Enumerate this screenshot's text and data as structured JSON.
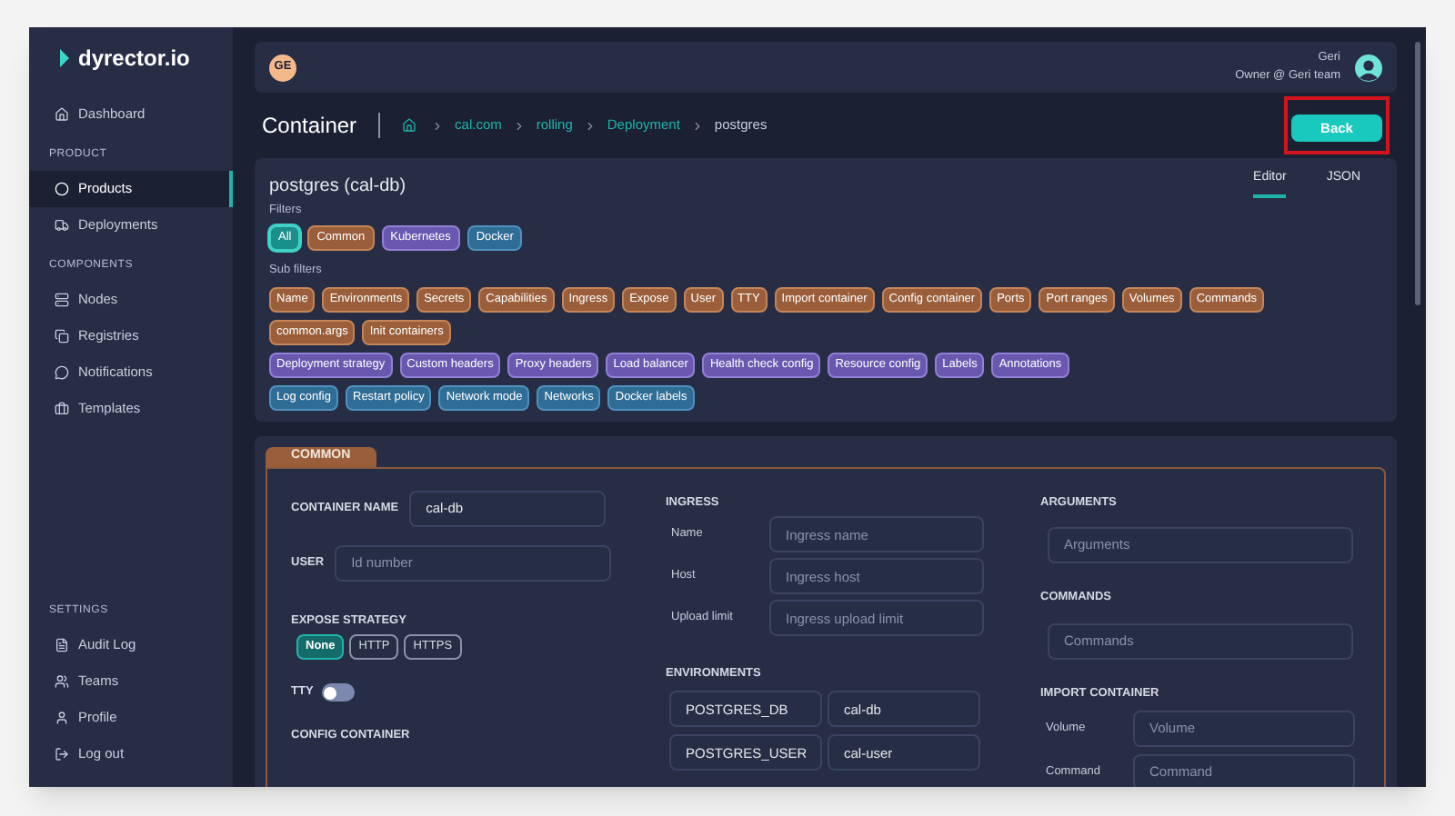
{
  "sidebar": {
    "logo": "dyrector.io",
    "sections": [
      {
        "items": [
          {
            "label": "Dashboard",
            "selected": false
          }
        ]
      },
      {
        "title": "PRODUCT",
        "items": [
          {
            "label": "Products",
            "selected": true
          },
          {
            "label": "Deployments",
            "selected": false
          }
        ]
      },
      {
        "title": "COMPONENTS",
        "items": [
          {
            "label": "Nodes",
            "selected": false
          },
          {
            "label": "Registries",
            "selected": false
          },
          {
            "label": "Notifications",
            "selected": false
          },
          {
            "label": "Templates",
            "selected": false
          }
        ]
      },
      {
        "title": "SETTINGS",
        "items": [
          {
            "label": "Audit Log",
            "selected": false
          },
          {
            "label": "Teams",
            "selected": false
          },
          {
            "label": "Profile",
            "selected": false
          },
          {
            "label": "Log out",
            "selected": false
          }
        ]
      }
    ]
  },
  "header": {
    "initials": "GE",
    "user_name": "Geri",
    "user_role": "Owner @ Geri team"
  },
  "page_title": "Container",
  "breadcrumb": [
    {
      "label": "cal.com",
      "link": true
    },
    {
      "label": "rolling",
      "link": true
    },
    {
      "label": "Deployment",
      "link": true
    },
    {
      "label": "postgres",
      "link": false
    }
  ],
  "back_button": {
    "label": "Back",
    "highlighted": true
  },
  "card": {
    "title": "postgres (cal-db)",
    "tabs": [
      {
        "label": "Editor",
        "selected": true
      },
      {
        "label": "JSON",
        "selected": false
      }
    ],
    "filters_label": "Filters",
    "filters": [
      {
        "label": "All",
        "kind": "all",
        "selected": true
      },
      {
        "label": "Common",
        "kind": "common",
        "selected": false
      },
      {
        "label": "Kubernetes",
        "kind": "kubernetes",
        "selected": false
      },
      {
        "label": "Docker",
        "kind": "docker",
        "selected": false
      }
    ],
    "sub_filters_label": "Sub filters",
    "sub_filters": [
      {
        "kind": "common",
        "tags": [
          "Name",
          "Environments",
          "Secrets",
          "Capabilities",
          "Ingress",
          "Expose",
          "User",
          "TTY",
          "Import container",
          "Config container",
          "Ports",
          "Port ranges",
          "Volumes",
          "Commands",
          "common.args",
          "Init containers"
        ]
      },
      {
        "kind": "kubernetes",
        "tags": [
          "Deployment strategy",
          "Custom headers",
          "Proxy headers",
          "Load balancer",
          "Health check config",
          "Resource config",
          "Labels",
          "Annotations"
        ]
      },
      {
        "kind": "docker",
        "tags": [
          "Log config",
          "Restart policy",
          "Network mode",
          "Networks",
          "Docker labels"
        ]
      }
    ]
  },
  "common": {
    "tab": "COMMON",
    "container_name": {
      "label": "CONTAINER NAME",
      "value": "cal-db"
    },
    "user": {
      "label": "USER",
      "placeholder": "Id number"
    },
    "expose_strategy": {
      "label": "EXPOSE STRATEGY",
      "options": [
        {
          "label": "None",
          "selected": true
        },
        {
          "label": "HTTP",
          "selected": false
        },
        {
          "label": "HTTPS",
          "selected": false
        }
      ]
    },
    "tty": {
      "label": "TTY",
      "on": false
    },
    "config_container": {
      "label": "CONFIG CONTAINER"
    },
    "ingress": {
      "title": "INGRESS",
      "fields": [
        {
          "label": "Name",
          "placeholder": "Ingress name"
        },
        {
          "label": "Host",
          "placeholder": "Ingress host"
        },
        {
          "label": "Upload limit",
          "placeholder": "Ingress upload limit"
        }
      ]
    },
    "environments": {
      "title": "ENVIRONMENTS",
      "rows": [
        {
          "key": "POSTGRES_DB",
          "value": "cal-db"
        },
        {
          "key": "POSTGRES_USER",
          "value": "cal-user"
        }
      ]
    },
    "arguments": {
      "title": "ARGUMENTS",
      "placeholder": "Arguments"
    },
    "commands": {
      "title": "COMMANDS",
      "placeholder": "Commands"
    },
    "import_container": {
      "title": "IMPORT CONTAINER",
      "fields": [
        {
          "label": "Volume",
          "placeholder": "Volume"
        },
        {
          "label": "Command",
          "placeholder": "Command"
        }
      ]
    }
  }
}
